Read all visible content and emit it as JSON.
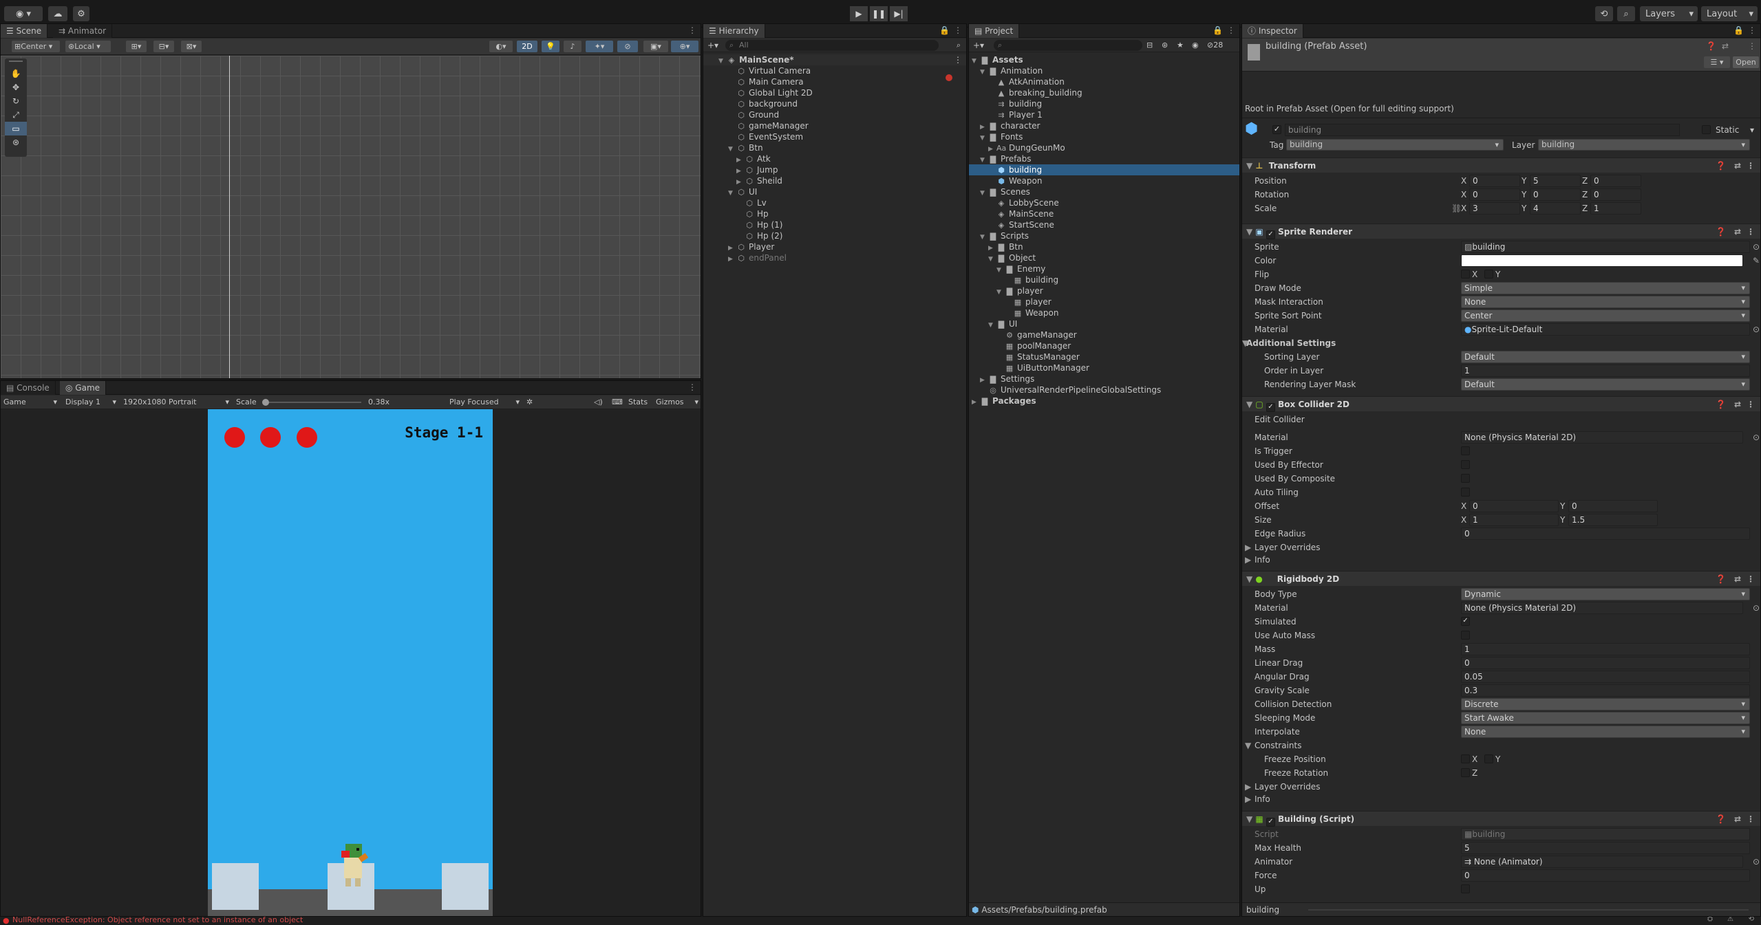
{
  "toolbar": {
    "layers": "Layers",
    "layout": "Layout"
  },
  "scene": {
    "tabs": [
      "Scene",
      "Animator"
    ],
    "pivot": "Center",
    "space": "Local",
    "mode2d": "2D"
  },
  "game": {
    "tabs": [
      "Console",
      "Game"
    ],
    "view": "Game",
    "display": "Display 1",
    "resolution": "1920x1080 Portrait",
    "scale_label": "Scale",
    "scale_value": "0.38x",
    "play_mode": "Play Focused",
    "stats": "Stats",
    "gizmos": "Gizmos",
    "stage": "Stage 1-1",
    "hp_count": 3,
    "colors": {
      "sky": "#2eaaea",
      "hp": "#e01818",
      "ground": "#555555",
      "block": "#c7d6e2"
    }
  },
  "hierarchy": {
    "title": "Hierarchy",
    "search": "All",
    "scene": "MainScene*",
    "items": [
      "Virtual Camera",
      "Main Camera",
      "Global Light 2D",
      "background",
      "Ground",
      "gameManager",
      "EventSystem",
      "Btn",
      "Atk",
      "Jump",
      "Sheild",
      "UI",
      "Lv",
      "Hp",
      "Hp (1)",
      "Hp (2)",
      "Player",
      "endPanel"
    ]
  },
  "project": {
    "title": "Project",
    "count": "28",
    "items": [
      "Assets",
      "Animation",
      "AtkAnimation",
      "breaking_building",
      "building",
      "Player 1",
      "character",
      "Fonts",
      "DungGeunMo",
      "Prefabs",
      "building",
      "Weapon",
      "Scenes",
      "LobbyScene",
      "MainScene",
      "StartScene",
      "Scripts",
      "Btn",
      "Object",
      "Enemy",
      "building",
      "player",
      "player",
      "Weapon",
      "UI",
      "gameManager",
      "poolManager",
      "StatusManager",
      "UiButtonManager",
      "Settings",
      "UniversalRenderPipelineGlobalSettings",
      "Packages"
    ],
    "path": "Assets/Prefabs/building.prefab"
  },
  "inspector": {
    "title": "Inspector",
    "asset": "building (Prefab Asset)",
    "open": "Open",
    "note": "Root in Prefab Asset (Open for full editing support)",
    "name": "building",
    "static": "Static",
    "tag_label": "Tag",
    "tag": "building",
    "layer_label": "Layer",
    "layer": "building",
    "transform": {
      "title": "Transform",
      "rows": [
        {
          "label": "Position",
          "x": "0",
          "y": "5",
          "z": "0"
        },
        {
          "label": "Rotation",
          "x": "0",
          "y": "0",
          "z": "0"
        },
        {
          "label": "Scale",
          "x": "3",
          "y": "4",
          "z": "1"
        }
      ]
    },
    "sprite_renderer": {
      "title": "Sprite Renderer",
      "sprite": "building",
      "color": "#ffffff",
      "draw_mode": "Simple",
      "mask": "None",
      "sort_point": "Center",
      "material": "Sprite-Lit-Default",
      "additional": "Additional Settings",
      "sorting_layer": "Default",
      "order": "1",
      "rendering_mask": "Default",
      "labels": [
        "Sprite",
        "Color",
        "Flip",
        "Draw Mode",
        "Mask Interaction",
        "Sprite Sort Point",
        "Material",
        "Sorting Layer",
        "Order in Layer",
        "Rendering Layer Mask"
      ]
    },
    "box_collider": {
      "title": "Box Collider 2D",
      "edit": "Edit Collider",
      "material": "None (Physics Material 2D)",
      "offset_x": "0",
      "offset_y": "0",
      "size_x": "1",
      "size_y": "1.5",
      "edge_radius": "0",
      "labels": [
        "Material",
        "Is Trigger",
        "Used By Effector",
        "Used By Composite",
        "Auto Tiling",
        "Offset",
        "Size",
        "Edge Radius",
        "Layer Overrides",
        "Info"
      ]
    },
    "rigidbody": {
      "title": "Rigidbody 2D",
      "body_type": "Dynamic",
      "material": "None (Physics Material 2D)",
      "mass": "1",
      "linear_drag": "0",
      "angular_drag": "0.05",
      "gravity": "0.3",
      "collision": "Discrete",
      "sleeping": "Start Awake",
      "interpolate": "None",
      "labels": [
        "Body Type",
        "Material",
        "Simulated",
        "Use Auto Mass",
        "Mass",
        "Linear Drag",
        "Angular Drag",
        "Gravity Scale",
        "Collision Detection",
        "Sleeping Mode",
        "Interpolate",
        "Constraints",
        "Freeze Position",
        "Freeze Rotation",
        "Layer Overrides",
        "Info"
      ]
    },
    "building_script": {
      "title": "Building (Script)",
      "script": "building",
      "max_health": "5",
      "animator": "None (Animator)",
      "force": "0",
      "labels": [
        "Script",
        "Max Health",
        "Animator",
        "Force",
        "Up"
      ]
    },
    "footer": "building"
  },
  "status": {
    "error": "NullReferenceException: Object reference not set to an instance of an object"
  }
}
